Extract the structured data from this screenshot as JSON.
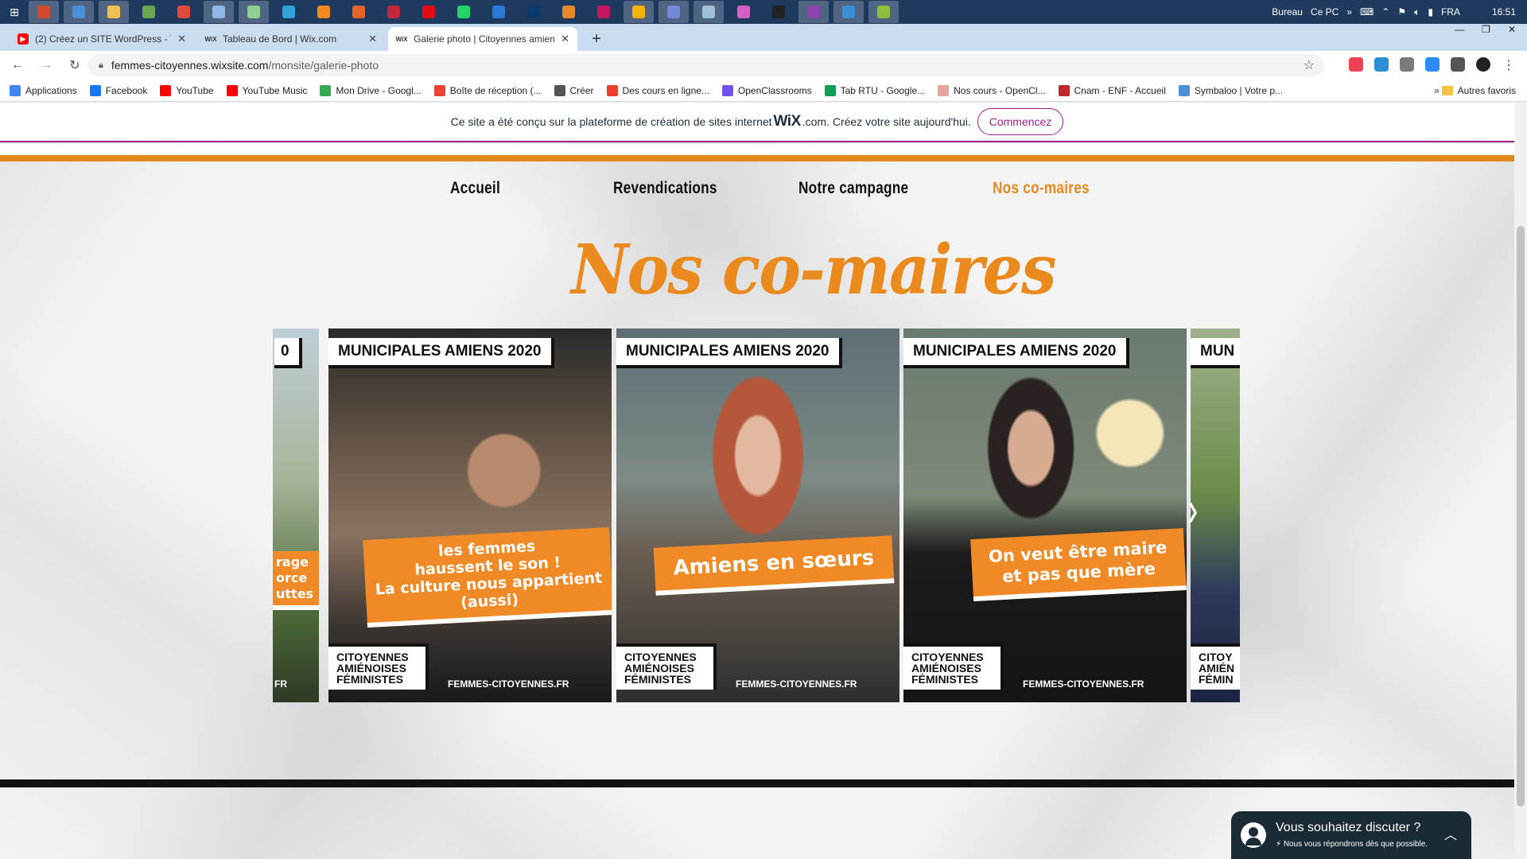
{
  "taskbar": {
    "tray_items": [
      "Bureau",
      "Ce PC",
      "»",
      "FRA",
      "16:51"
    ],
    "apps": [
      {
        "icon": "tools-icon",
        "color": "#d24a2b"
      },
      {
        "icon": "monitor-icon",
        "color": "#4a90d9"
      },
      {
        "icon": "folder-icon",
        "color": "#f2c14e"
      },
      {
        "icon": "settings-app-icon",
        "color": "#6aa84f"
      },
      {
        "icon": "chrome-red-icon",
        "color": "#e24b3b"
      },
      {
        "icon": "document-icon",
        "color": "#8fb8e8"
      },
      {
        "icon": "files-icon",
        "color": "#8fcf8f"
      },
      {
        "icon": "edge-icon",
        "color": "#2fa3d8"
      },
      {
        "icon": "vlc-icon",
        "color": "#f08a1e"
      },
      {
        "icon": "firefox-icon",
        "color": "#e8632b"
      },
      {
        "icon": "camera-icon",
        "color": "#c0273a"
      },
      {
        "icon": "netflix-icon",
        "color": "#e50914"
      },
      {
        "icon": "whatsapp-icon",
        "color": "#25d366"
      },
      {
        "icon": "vscode-icon",
        "color": "#2b7bd4"
      },
      {
        "icon": "photoshop-icon",
        "color": "#0b3a6e"
      },
      {
        "icon": "illustrator-icon",
        "color": "#e8862a"
      },
      {
        "icon": "indesign-icon",
        "color": "#c2185b"
      },
      {
        "icon": "chrome-icon",
        "color": "#f4b400"
      },
      {
        "icon": "discord-icon",
        "color": "#7289da"
      },
      {
        "icon": "notes-icon",
        "color": "#9fc0d8"
      },
      {
        "icon": "itunes-icon",
        "color": "#d45fc7"
      },
      {
        "icon": "github-icon",
        "color": "#222222"
      },
      {
        "icon": "podcast-icon",
        "color": "#8e44ad"
      },
      {
        "icon": "globe-icon",
        "color": "#3a8fd8"
      },
      {
        "icon": "gamepad-icon",
        "color": "#8bbf3b"
      }
    ]
  },
  "tabs": [
    {
      "title": "(2) Créez un SITE WordPress - Tu",
      "favicon": "youtube-icon"
    },
    {
      "title": "Tableau de Bord | Wix.com",
      "favicon": "wix-icon"
    },
    {
      "title": "Galerie photo | Citoyennes amien",
      "favicon": "wix-icon",
      "active": true
    }
  ],
  "address": {
    "domain": "femmes-citoyennes.wixsite.com",
    "path": "/monsite/galerie-photo"
  },
  "bookmarks": [
    {
      "label": "Applications",
      "color": "#4285f4"
    },
    {
      "label": "Facebook",
      "color": "#1877f2"
    },
    {
      "label": "YouTube",
      "color": "#ff0000"
    },
    {
      "label": "YouTube Music",
      "color": "#ff0000"
    },
    {
      "label": "Mon Drive - Googl...",
      "color": "#34a853"
    },
    {
      "label": "Boîte de réception (...",
      "color": "#ea4335"
    },
    {
      "label": "Créer",
      "color": "#555555"
    },
    {
      "label": "Des cours en ligne...",
      "color": "#e8412c"
    },
    {
      "label": "OpenClassrooms",
      "color": "#7451eb"
    },
    {
      "label": "Tab RTU - Google...",
      "color": "#0f9d58"
    },
    {
      "label": "Nos cours - OpenCl...",
      "color": "#e8a3a3"
    },
    {
      "label": "Cnam - ENF - Accueil",
      "color": "#c1272d"
    },
    {
      "label": "Symbaloo | Votre p...",
      "color": "#4a8fd8"
    }
  ],
  "bookmarks_more": "»",
  "bookmarks_other": "Autres favoris",
  "wix_banner": {
    "text": "Ce site a été conçu sur la plateforme de création de sites internet",
    "brand": "WiX",
    "brand_suffix": ".com. Créez votre site aujourd'hui.",
    "cta": "Commencez"
  },
  "nav": {
    "items": [
      "Accueil",
      "Revendications",
      "Notre campagne",
      "Nos co-maires"
    ],
    "current_index": 3
  },
  "page_title": "Nos co-maires",
  "gallery": {
    "cards": [
      {
        "header": "0",
        "slogan": "rage\norce\nuttes",
        "logo": "",
        "site": "FR"
      },
      {
        "header": "MUNICIPALES AMIENS 2020",
        "slogan": "les femmes\nhaussent le son !\nLa culture nous appartient\n(aussi)",
        "logo": "CITOYENNES\nAMIÉNOISES\nFÉMINISTES",
        "site": "FEMMES-CITOYENNES.FR"
      },
      {
        "header": "MUNICIPALES AMIENS 2020",
        "slogan": "Amiens en sœurs",
        "logo": "CITOYENNES\nAMIÉNOISES\nFÉMINISTES",
        "site": "FEMMES-CITOYENNES.FR"
      },
      {
        "header": "MUNICIPALES AMIENS 2020",
        "slogan": "On veut être maire\net pas que mère",
        "logo": "CITOYENNES\nAMIÉNOISES\nFÉMINISTES",
        "site": "FEMMES-CITOYENNES.FR"
      },
      {
        "header": "MUN",
        "slogan": "",
        "logo": "CITOY\nAMIÉN\nFÉMIN",
        "site": ""
      }
    ],
    "next_arrow": "›"
  },
  "chat": {
    "heading": "Vous souhaitez discuter ?",
    "sub": "Nous vous répondrons dès que possible."
  },
  "colors": {
    "accent_orange": "#e58a1e",
    "wix_purple": "#a01e8c",
    "chat_bg": "#1b2b36"
  }
}
